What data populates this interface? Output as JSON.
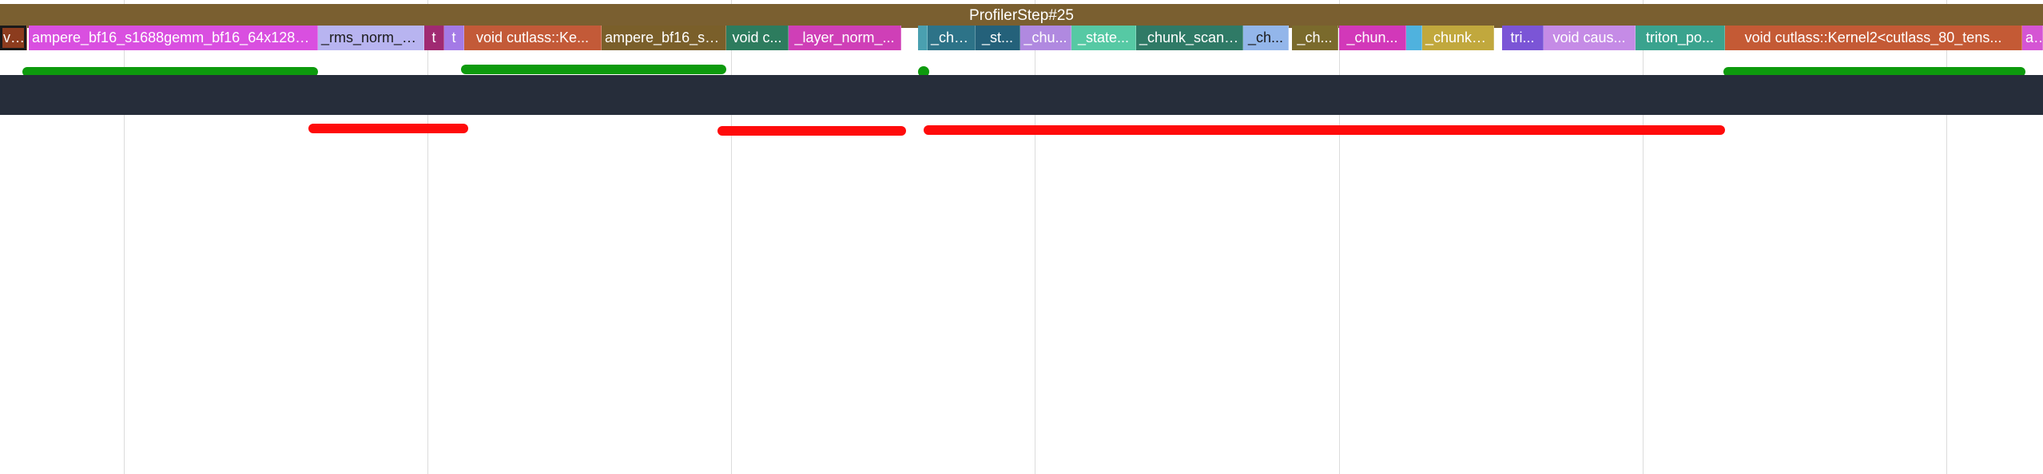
{
  "timeline": {
    "profiler_step_label": "ProfilerStep#25",
    "kernels": [
      {
        "label": "vo...",
        "color": "#8c3c1e",
        "selected": true
      },
      {
        "label": "ampere_bf16_s1688gemm_bf16_64x128_sl...",
        "color": "#d94fe0"
      },
      {
        "label": "_rms_norm_bw...",
        "color": "#b8b4f0",
        "dark_text": true
      },
      {
        "label": "t",
        "color": "#a02a72"
      },
      {
        "label": "t",
        "color": "#a47ae6"
      },
      {
        "label": "void cutlass::Ke...",
        "color": "#c35a38"
      },
      {
        "label": "ampere_bf16_s1...",
        "color": "#7a5f2a"
      },
      {
        "label": "void c...",
        "color": "#2d7c5e"
      },
      {
        "label": "_layer_norm_...",
        "color": "#cf3fb7"
      },
      {
        "label": "",
        "color": "#4aa0b0"
      },
      {
        "label": "_chu...",
        "color": "#2d7388"
      },
      {
        "label": "_st...",
        "color": "#24617a"
      },
      {
        "label": "_chu...",
        "color": "#b089e0"
      },
      {
        "label": "_state...",
        "color": "#56c9a4"
      },
      {
        "label": "_chunk_scan_...",
        "color": "#2f7a66"
      },
      {
        "label": "_ch...",
        "color": "#93b6ea",
        "dark_text": true
      },
      {
        "label": "_ch...",
        "color": "#7a6a2c"
      },
      {
        "label": "_chun...",
        "color": "#d238b9"
      },
      {
        "label": "",
        "color": "#4fb2de"
      },
      {
        "label": "_chunk_...",
        "color": "#c1a83d"
      },
      {
        "label": "tri...",
        "color": "#7b55d6"
      },
      {
        "label": "void caus...",
        "color": "#c58be6"
      },
      {
        "label": "triton_po...",
        "color": "#3aa38e"
      },
      {
        "label": "void cutlass::Kernel2<cutlass_80_tens...",
        "color": "#c45a35"
      },
      {
        "label": "am",
        "color": "#d555d4"
      }
    ]
  }
}
